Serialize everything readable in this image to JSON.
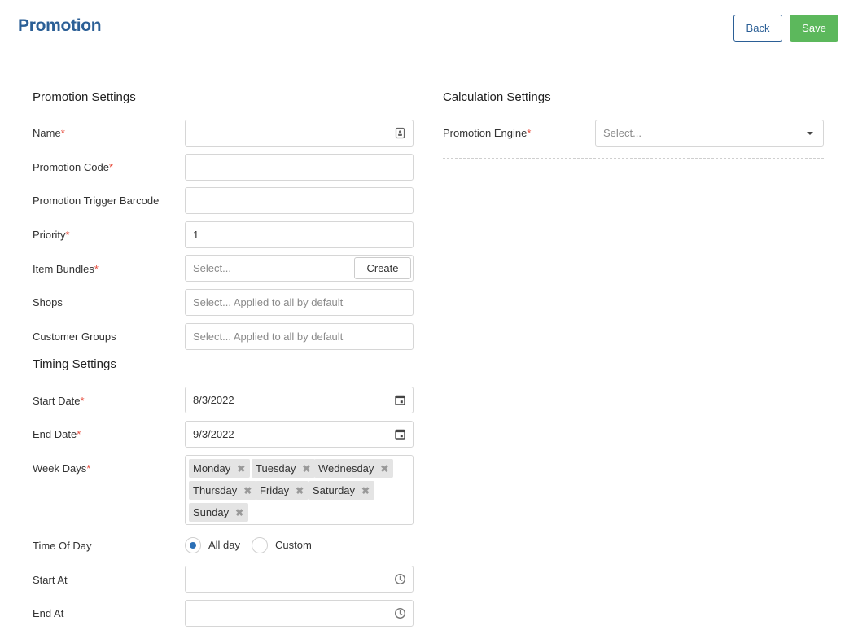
{
  "header": {
    "title": "Promotion",
    "back_label": "Back",
    "save_label": "Save"
  },
  "promotion_settings": {
    "title": "Promotion Settings",
    "name": {
      "label": "Name",
      "value": ""
    },
    "code": {
      "label": "Promotion Code",
      "value": ""
    },
    "trigger_barcode": {
      "label": "Promotion Trigger Barcode",
      "value": ""
    },
    "priority": {
      "label": "Priority",
      "value": "1"
    },
    "item_bundles": {
      "label": "Item Bundles",
      "placeholder": "Select...",
      "create_label": "Create"
    },
    "shops": {
      "label": "Shops",
      "placeholder": "Select... Applied to all by default"
    },
    "customer_groups": {
      "label": "Customer Groups",
      "placeholder": "Select... Applied to all by default"
    }
  },
  "timing_settings": {
    "title": "Timing Settings",
    "start_date": {
      "label": "Start Date",
      "value": "8/3/2022"
    },
    "end_date": {
      "label": "End Date",
      "value": "9/3/2022"
    },
    "week_days": {
      "label": "Week Days",
      "selected": [
        "Monday",
        "Tuesday",
        "Wednesday",
        "Thursday",
        "Friday",
        "Saturday",
        "Sunday"
      ]
    },
    "time_of_day": {
      "label": "Time Of Day",
      "options": [
        "All day",
        "Custom"
      ],
      "selected": "All day"
    },
    "start_at": {
      "label": "Start At",
      "value": ""
    },
    "end_at": {
      "label": "End At",
      "value": ""
    }
  },
  "calculation_settings": {
    "title": "Calculation Settings",
    "engine": {
      "label": "Promotion Engine",
      "placeholder": "Select..."
    }
  },
  "required_marker": "*",
  "colors": {
    "brand": "#2b5f96",
    "save": "#5cb85c",
    "required": "#e74c3c",
    "radio_checked": "#2b6fb6"
  }
}
